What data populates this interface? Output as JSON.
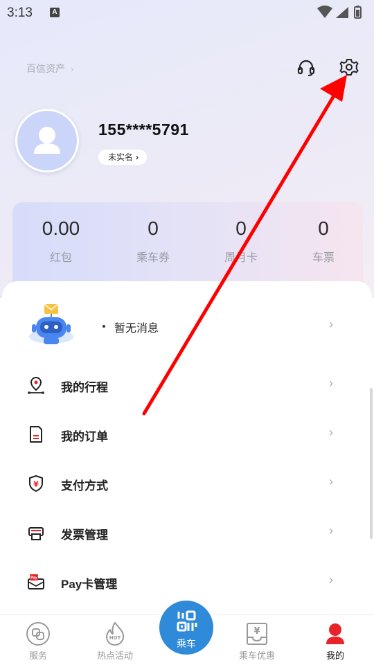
{
  "status_bar": {
    "time": "3:13",
    "notification_letter": "A"
  },
  "header": {
    "brand_link": "百信资产",
    "headset_icon": "headset-icon",
    "settings_icon": "gear-icon"
  },
  "profile": {
    "phone": "155****5791",
    "verify_label": "未实名"
  },
  "stats": [
    {
      "value": "0.00",
      "label": "红包"
    },
    {
      "value": "0",
      "label": "乘车券"
    },
    {
      "value": "0",
      "label": "周月卡"
    },
    {
      "value": "0",
      "label": "车票"
    }
  ],
  "messages": {
    "text": "暂无消息"
  },
  "menu": [
    {
      "label": "我的行程",
      "icon": "location-pin-icon"
    },
    {
      "label": "我的订单",
      "icon": "order-doc-icon"
    },
    {
      "label": "支付方式",
      "icon": "yuan-shield-icon"
    },
    {
      "label": "发票管理",
      "icon": "invoice-printer-icon"
    },
    {
      "label": "Pay卡管理",
      "icon": "pay-card-icon"
    }
  ],
  "bottom_nav": {
    "service": "服务",
    "events": "热点活动",
    "ride": "乘车",
    "discounts": "乘车优惠",
    "mine": "我的"
  },
  "colors": {
    "accent_red": "#e8232a",
    "ride_blue": "#2f8ad9",
    "annotation_arrow": "#ff0000"
  }
}
